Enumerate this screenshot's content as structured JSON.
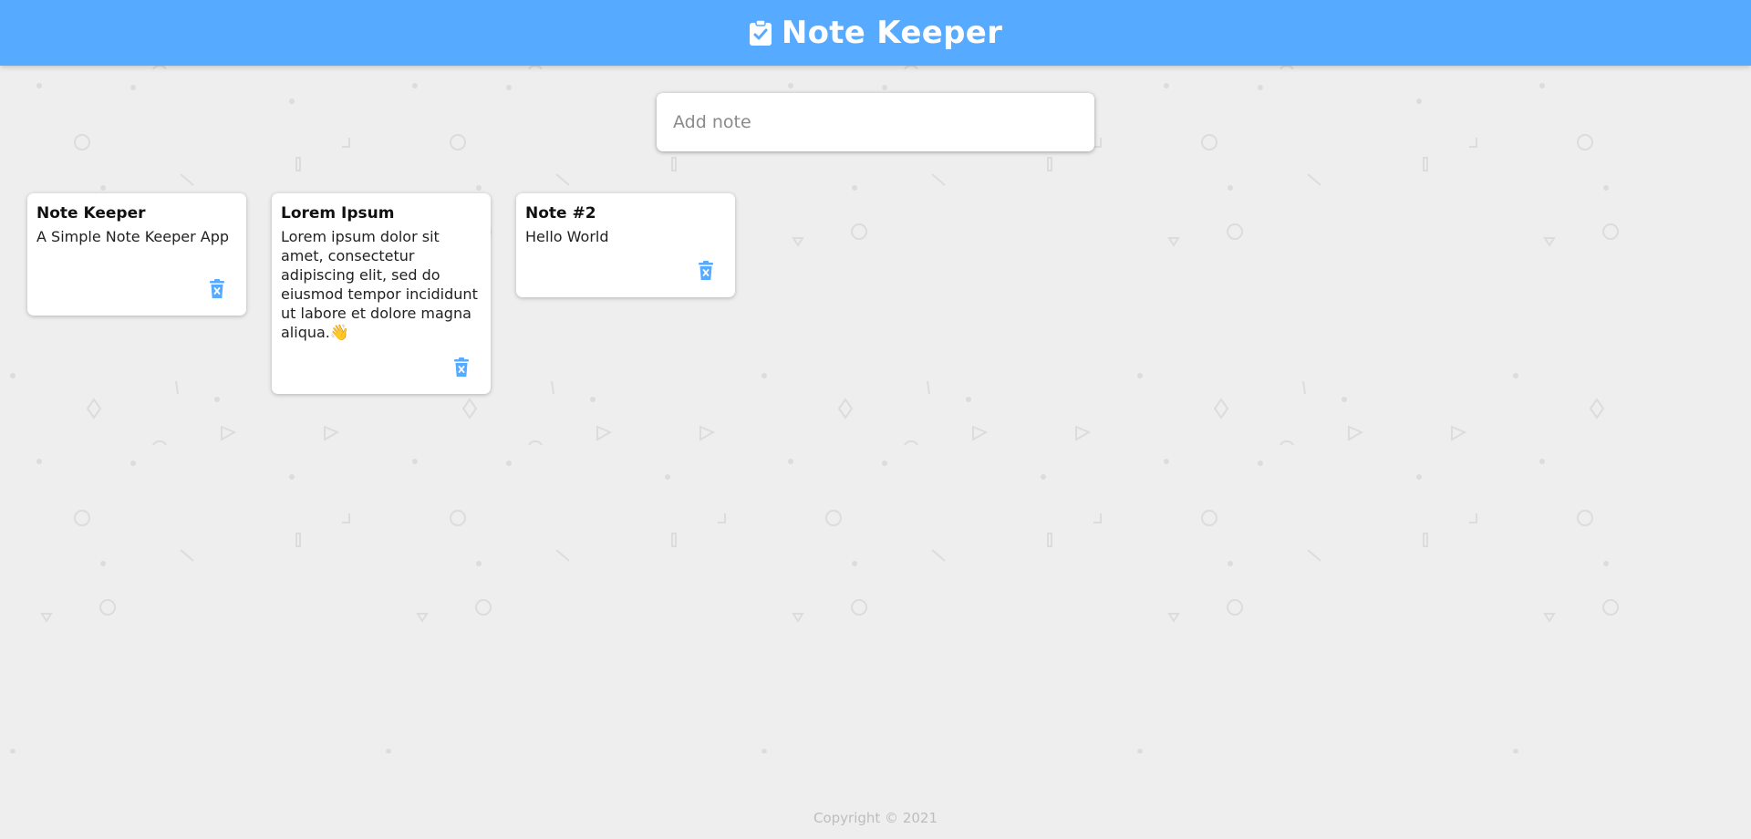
{
  "app": {
    "title": "Note Keeper",
    "logo_icon": "clipboard-check-icon"
  },
  "colors": {
    "header": "#56aaff",
    "accent": "#56aaff",
    "background": "#eeeeee",
    "card": "#ffffff"
  },
  "add_note": {
    "placeholder": "Add note",
    "value": ""
  },
  "notes": [
    {
      "title": "Note Keeper",
      "content": "A Simple Note Keeper App",
      "emoji": "",
      "delete_icon": "trash-icon"
    },
    {
      "title": "Lorem Ipsum",
      "content": "Lorem ipsum dolor sit amet, consectetur adipiscing elit, sed do eiusmod tempor incididunt ut labore et dolore magna aliqua.",
      "emoji": "👋",
      "delete_icon": "trash-icon"
    },
    {
      "title": "Note #2",
      "content": "Hello World",
      "emoji": "",
      "delete_icon": "trash-icon"
    }
  ],
  "footer": {
    "copyright": "Copyright © 2021"
  }
}
